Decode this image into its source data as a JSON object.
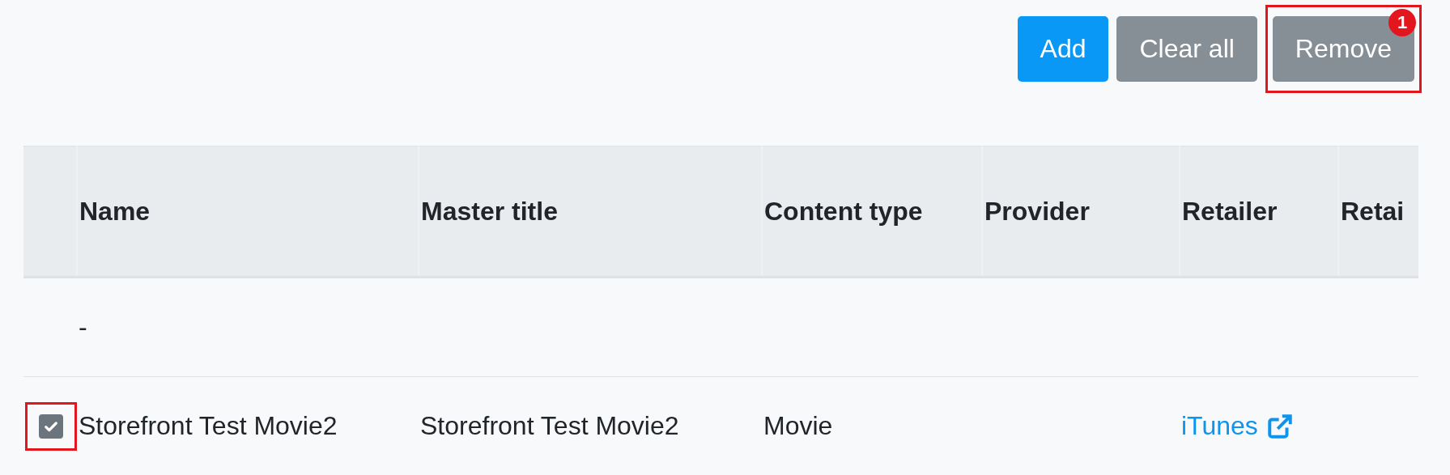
{
  "toolbar": {
    "buttons": [
      {
        "label": "Add",
        "kind": "primary",
        "highlighted": false
      },
      {
        "label": "Clear all",
        "kind": "secondary",
        "highlighted": false
      },
      {
        "label": "Remove",
        "kind": "secondary",
        "highlighted": true,
        "badge": "1"
      }
    ]
  },
  "table": {
    "columns": [
      "",
      "Name",
      "Master title",
      "Content type",
      "Provider",
      "Retailer",
      "Retai"
    ],
    "rows": [
      {
        "kind": "empty",
        "cells": [
          {
            "text": ""
          },
          {
            "text": "-"
          },
          {
            "text": ""
          },
          {
            "text": ""
          },
          {
            "text": ""
          },
          {
            "text": ""
          },
          {
            "text": ""
          }
        ]
      },
      {
        "kind": "item",
        "checked": true,
        "highlighted": true,
        "cells": [
          {
            "text": ""
          },
          {
            "text": "Storefront Test Movie2"
          },
          {
            "text": "Storefront Test Movie2"
          },
          {
            "text": "Movie"
          },
          {
            "text": ""
          },
          {
            "text": "iTunes",
            "kind": "link"
          },
          {
            "text": ""
          }
        ]
      }
    ]
  }
}
